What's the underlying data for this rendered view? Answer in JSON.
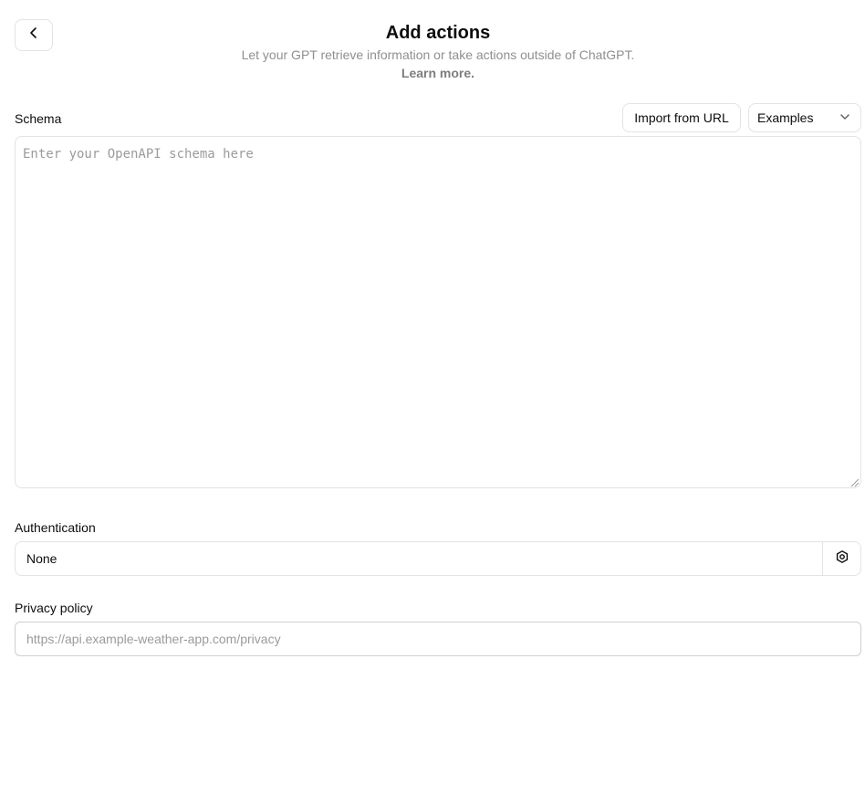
{
  "header": {
    "title": "Add actions",
    "subtitle": "Let your GPT retrieve information or take actions outside of ChatGPT.",
    "learn_more": "Learn more."
  },
  "back_button": {
    "icon": "chevron-left-icon"
  },
  "schema": {
    "label": "Schema",
    "import_button": "Import from URL",
    "examples_select": {
      "selected": "Examples",
      "icon": "chevron-down-icon"
    },
    "value": "",
    "placeholder": "Enter your OpenAPI schema here"
  },
  "authentication": {
    "label": "Authentication",
    "value": "None",
    "settings_icon": "gear-icon"
  },
  "privacy_policy": {
    "label": "Privacy policy",
    "value": "",
    "placeholder": "https://api.example-weather-app.com/privacy"
  }
}
